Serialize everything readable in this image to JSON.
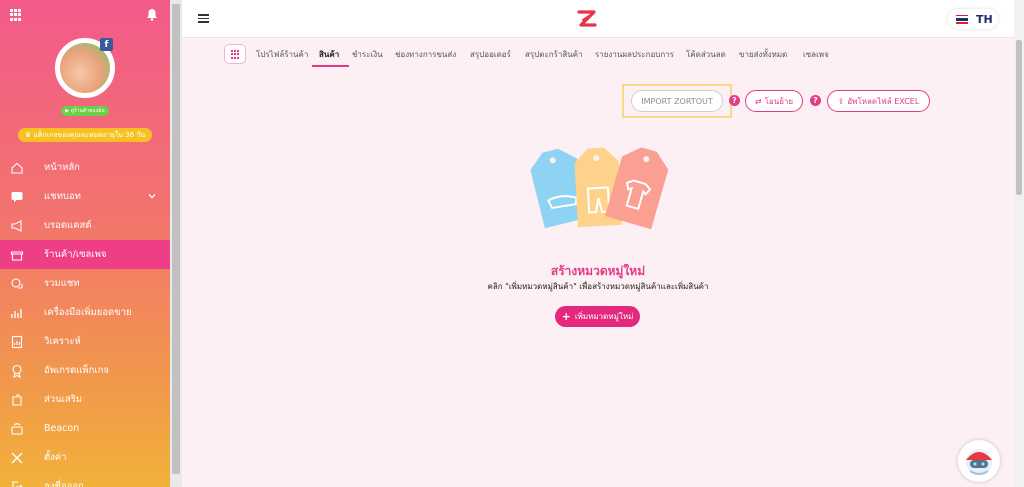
{
  "sidebar": {
    "watch_label": "ดูร้านค้าของฉัน",
    "expire_text": "แพ็กเกจของคุณจะหมดอายุใน 36 วัน",
    "items": [
      {
        "label": "หน้าหลัก",
        "icon": "home-icon"
      },
      {
        "label": "แชทบอท",
        "icon": "chat-icon"
      },
      {
        "label": "บรอดแคสต์",
        "icon": "megaphone-icon"
      },
      {
        "label": "ร้านค้า/เซลเพจ",
        "icon": "store-icon"
      },
      {
        "label": "รวมแชท",
        "icon": "chats-icon"
      },
      {
        "label": "เครื่องมือเพิ่มยอดขาย",
        "icon": "chart-icon"
      },
      {
        "label": "วิเคราะห์",
        "icon": "report-icon"
      },
      {
        "label": "อัพเกรดแพ็กเกจ",
        "icon": "badge-icon"
      },
      {
        "label": "ส่วนเสริม",
        "icon": "plugin-icon"
      },
      {
        "label": "Beacon",
        "icon": "beacon-icon"
      },
      {
        "label": "ตั้งค่า",
        "icon": "tools-icon"
      },
      {
        "label": "ลงชื่อออก",
        "icon": "logout-icon"
      }
    ]
  },
  "topbar": {
    "lang": "TH"
  },
  "tabs": [
    "โปรไฟล์ร้านค้า",
    "สินค้า",
    "ชำระเงิน",
    "ช่องทางการขนส่ง",
    "สรุปออเดอร์",
    "สรุปตะกร้าสินค้า",
    "รายงานผลประกอบการ",
    "โค้ดส่วนลด",
    "ขายส่งทั้งหมด",
    "เซลเพจ"
  ],
  "actions": {
    "import_label": "IMPORT ZORTOUT",
    "transfer_label": "โอนย้าย",
    "upload_label": "อัพโหลดไฟล์ EXCEL",
    "help_mark": "?"
  },
  "empty": {
    "title": "สร้างหมวดหมู่ใหม่",
    "desc": "คลิก \"เพิ่มหมวดหมู่สินค้า\" เพื่อสร้างหมวดหมู่สินค้าและเพิ่มสินค้า",
    "add_label": "เพิ่มหมวดหมู่ใหม่",
    "add_plus": "+"
  },
  "colors": {
    "accent": "#e23c86",
    "highlight": "#f8d987"
  }
}
